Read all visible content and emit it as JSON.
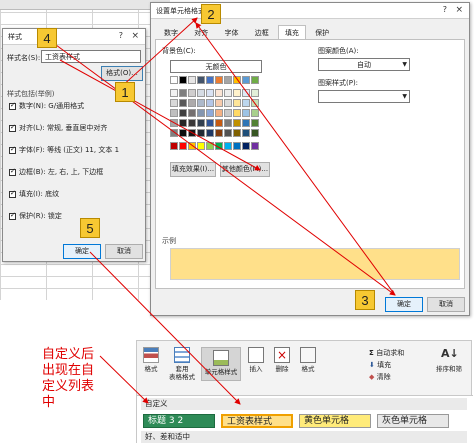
{
  "style_dialog": {
    "title": "样式",
    "help": "?",
    "close": "×",
    "style_name_label": "样式名(S):",
    "style_name_value": "工资表样式",
    "format_button": "格式(O)...",
    "includes_label": "样式包括(举例)",
    "options": [
      {
        "label": "数字(N): G/通用格式",
        "checked": true
      },
      {
        "label": "对齐(L): 常规, 垂直居中对齐",
        "checked": true
      },
      {
        "label": "字体(F): 等线 (正文) 11, 文本 1",
        "checked": true
      },
      {
        "label": "边框(B): 左, 右, 上, 下边框",
        "checked": true
      },
      {
        "label": "填充(I): 底纹",
        "checked": true
      },
      {
        "label": "保护(R): 锁定",
        "checked": true
      }
    ],
    "ok_button": "确定",
    "cancel_button": "取消"
  },
  "format_dialog": {
    "title": "设置单元格格式",
    "help": "?",
    "close": "×",
    "tabs": [
      "数字",
      "对齐",
      "字体",
      "边框",
      "填充",
      "保护"
    ],
    "active_tab": "填充",
    "bg_color_label": "背景色(C):",
    "no_color_label": "无颜色",
    "pattern_color_label": "图案颜色(A):",
    "pattern_color_value": "自动",
    "pattern_style_label": "图案样式(P):",
    "fill_effects_button": "填充效果(I)...",
    "more_colors_button": "其他颜色(M)...",
    "sample_label": "示例",
    "sample_color": "#ffe08a",
    "ok_button": "确定",
    "cancel_button": "取消"
  },
  "callouts": [
    "1",
    "2",
    "3",
    "4",
    "5"
  ],
  "caption": [
    "自定义后",
    "出现在自",
    "定义列表",
    "中"
  ],
  "ribbon": {
    "buttons": [
      {
        "label": "格式",
        "sub": "",
        "icon": "conditional-format-icon"
      },
      {
        "label": "套用",
        "sub": "表格格式",
        "icon": "table-format-icon"
      },
      {
        "label": "单元格样式",
        "sub": "",
        "icon": "cell-styles-icon"
      },
      {
        "label": "插入",
        "sub": "",
        "icon": "insert-icon"
      },
      {
        "label": "删除",
        "sub": "",
        "icon": "delete-icon"
      },
      {
        "label": "格式",
        "sub": "",
        "icon": "format-icon"
      }
    ],
    "editing": [
      {
        "label": "自动求和",
        "icon": "sigma-icon"
      },
      {
        "label": "填充",
        "icon": "fill-down-icon"
      },
      {
        "label": "清除",
        "icon": "eraser-icon"
      }
    ],
    "sort_label": "排序和筛",
    "custom_header": "自定义",
    "custom_styles": [
      "标题 3 2",
      "工资表样式",
      "黄色单元格",
      "灰色单元格"
    ],
    "good_bad_header": "好、差和适中"
  }
}
